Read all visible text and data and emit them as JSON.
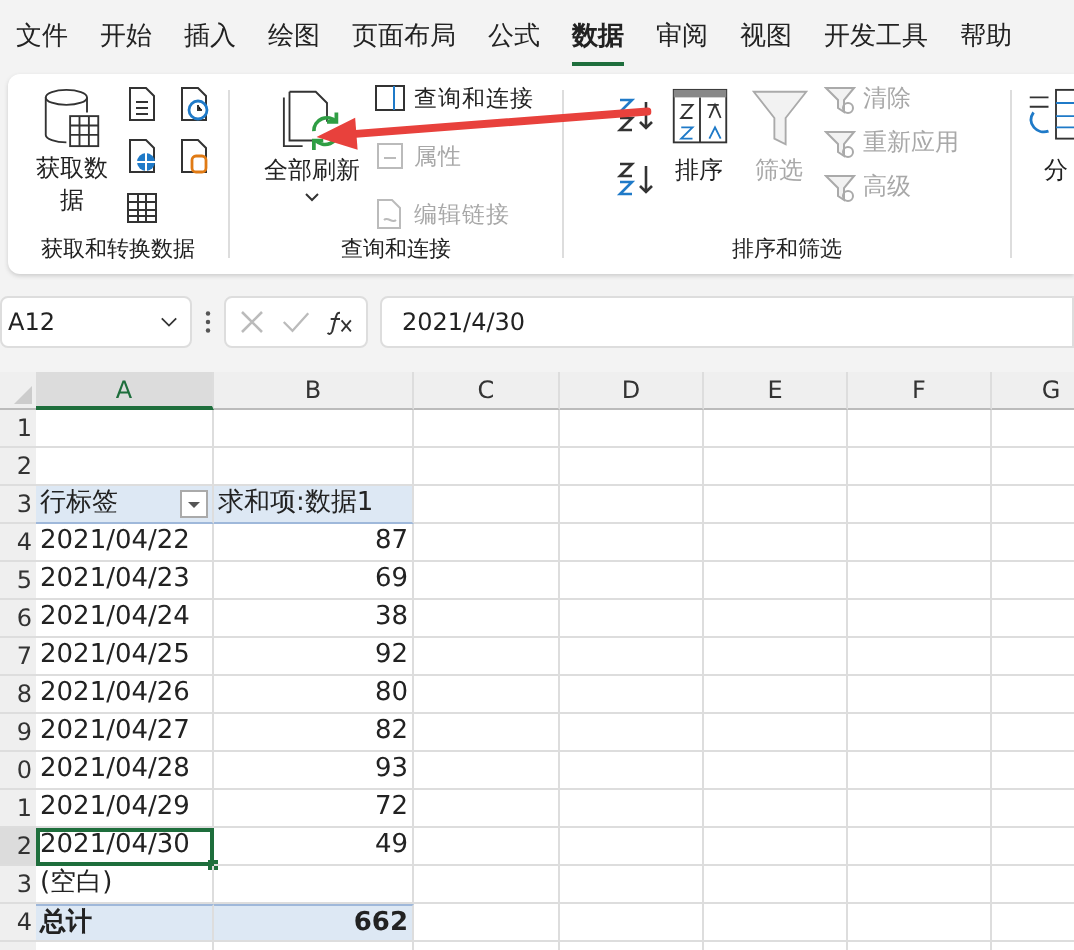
{
  "tabs": [
    {
      "label": "文件",
      "selected": false
    },
    {
      "label": "开始",
      "selected": false
    },
    {
      "label": "插入",
      "selected": false
    },
    {
      "label": "绘图",
      "selected": false
    },
    {
      "label": "页面布局",
      "selected": false
    },
    {
      "label": "公式",
      "selected": false
    },
    {
      "label": "数据",
      "selected": true
    },
    {
      "label": "审阅",
      "selected": false
    },
    {
      "label": "视图",
      "selected": false
    },
    {
      "label": "开发工具",
      "selected": false
    },
    {
      "label": "帮助",
      "selected": false
    }
  ],
  "ribbon": {
    "groups": [
      {
        "label": "获取和转换数据"
      },
      {
        "label": "查询和连接"
      },
      {
        "label": "排序和筛选"
      }
    ],
    "get_data": {
      "label": "获取数据"
    },
    "refresh_all": {
      "label": "全部刷新"
    },
    "query_items": [
      {
        "label": "查询和连接",
        "disabled": false
      },
      {
        "label": "属性",
        "disabled": true
      },
      {
        "label": "编辑链接",
        "disabled": true
      }
    ],
    "sort": {
      "label": "排序"
    },
    "filter": {
      "label": "筛选",
      "disabled": true
    },
    "filter_items": [
      {
        "label": "清除",
        "disabled": true
      },
      {
        "label": "重新应用",
        "disabled": true
      },
      {
        "label": "高级",
        "disabled": true
      }
    ],
    "text_to_columns": {
      "label": "分"
    }
  },
  "formula_bar": {
    "name_box": "A12",
    "value": "2021/4/30"
  },
  "sheet": {
    "columns": [
      "A",
      "B",
      "C",
      "D",
      "E",
      "F",
      "G"
    ],
    "row_numbers": [
      "1",
      "2",
      "3",
      "4",
      "5",
      "6",
      "7",
      "8",
      "9",
      "0",
      "1",
      "2",
      "3",
      "4"
    ],
    "header": [
      "行标签",
      "求和项:数据1"
    ],
    "rows": [
      {
        "label": "2021/04/22",
        "value": "87",
        "selected": false
      },
      {
        "label": "2021/04/23",
        "value": "69",
        "selected": false
      },
      {
        "label": "2021/04/24",
        "value": "38",
        "selected": false
      },
      {
        "label": "2021/04/25",
        "value": "92",
        "selected": false
      },
      {
        "label": "2021/04/26",
        "value": "80",
        "selected": false
      },
      {
        "label": "2021/04/27",
        "value": "82",
        "selected": false
      },
      {
        "label": "2021/04/28",
        "value": "93",
        "selected": false
      },
      {
        "label": "2021/04/29",
        "value": "72",
        "selected": false
      },
      {
        "label": "2021/04/30",
        "value": "49",
        "selected": true
      },
      {
        "label": "(空白)",
        "value": null,
        "selected": false
      }
    ],
    "total": [
      "总计",
      "662"
    ]
  }
}
